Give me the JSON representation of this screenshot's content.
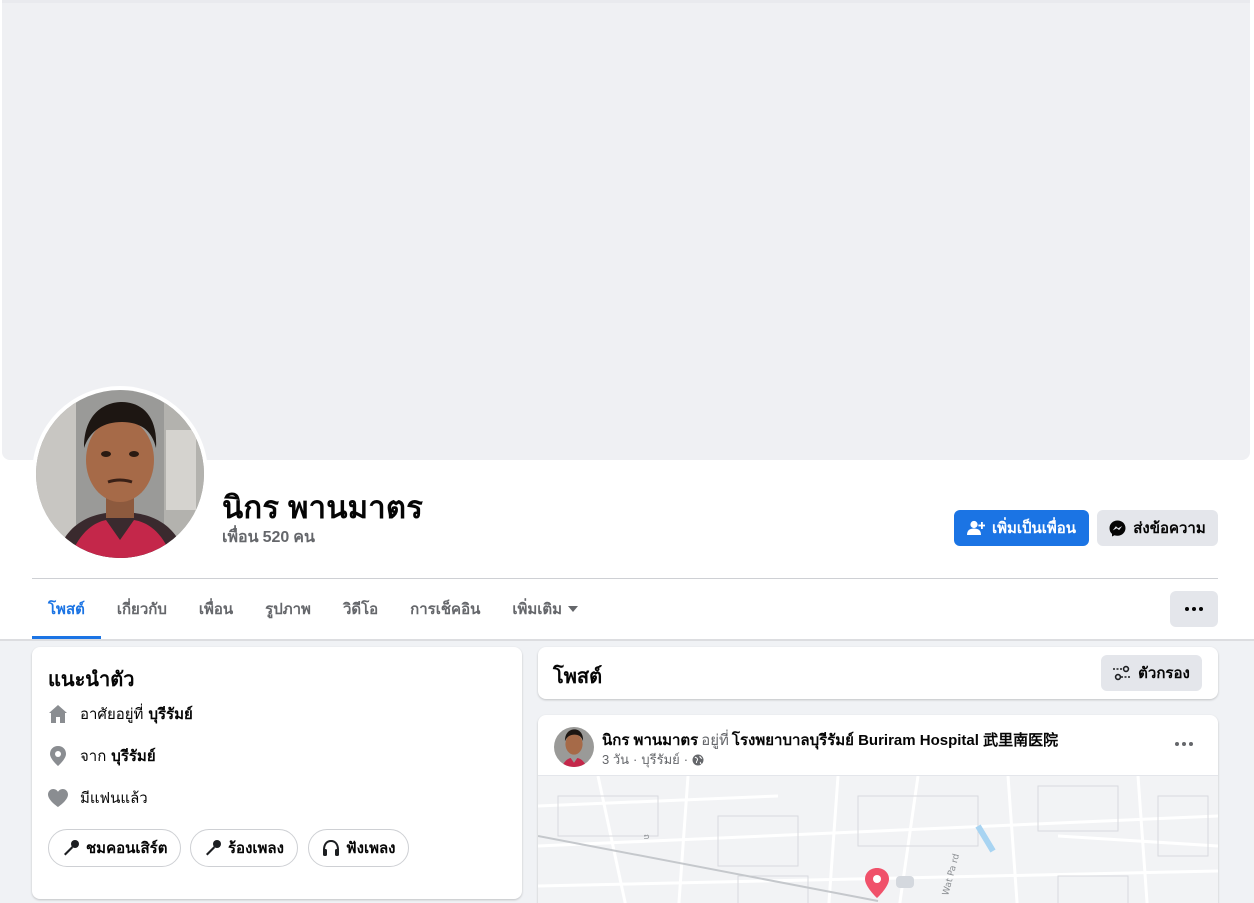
{
  "profile": {
    "name": "นิกร พานมาตร",
    "friends_label": "เพื่อน",
    "friends_count": "520",
    "friends_unit": "คน"
  },
  "actions": {
    "add_friend": "เพิ่มเป็นเพื่อน",
    "message": "ส่งข้อความ"
  },
  "tabs": [
    {
      "label": "โพสต์",
      "active": true
    },
    {
      "label": "เกี่ยวกับ"
    },
    {
      "label": "เพื่อน"
    },
    {
      "label": "รูปภาพ"
    },
    {
      "label": "วิดีโอ"
    },
    {
      "label": "การเช็คอิน"
    },
    {
      "label": "เพิ่มเติม"
    }
  ],
  "intro": {
    "title": "แนะนำตัว",
    "lives_in_prefix": "อาศัยอยู่ที่",
    "lives_in_place": "บุรีรัมย์",
    "from_prefix": "จาก",
    "from_place": "บุรีรัมย์",
    "relationship": "มีแฟนแล้ว",
    "hobbies": [
      "ชมคอนเสิร์ต",
      "ร้องเพลง",
      "ฟังเพลง"
    ]
  },
  "posts": {
    "title": "โพสต์",
    "filter_label": "ตัวกรอง"
  },
  "post": {
    "author": "นิกร พานมาตร",
    "at_label": "อยู่ที่",
    "location": "โรงพยาบาลบุรีรัมย์ Buriram Hospital 武里南医院",
    "time": "3 วัน",
    "place": "บุรีรัมย์",
    "map_street_labels": [
      "Wat Pa rd",
      "ถ"
    ]
  },
  "colors": {
    "brand_blue": "#1b74e4",
    "background": "#f0f2f5",
    "map_pin": "#f0516a"
  }
}
